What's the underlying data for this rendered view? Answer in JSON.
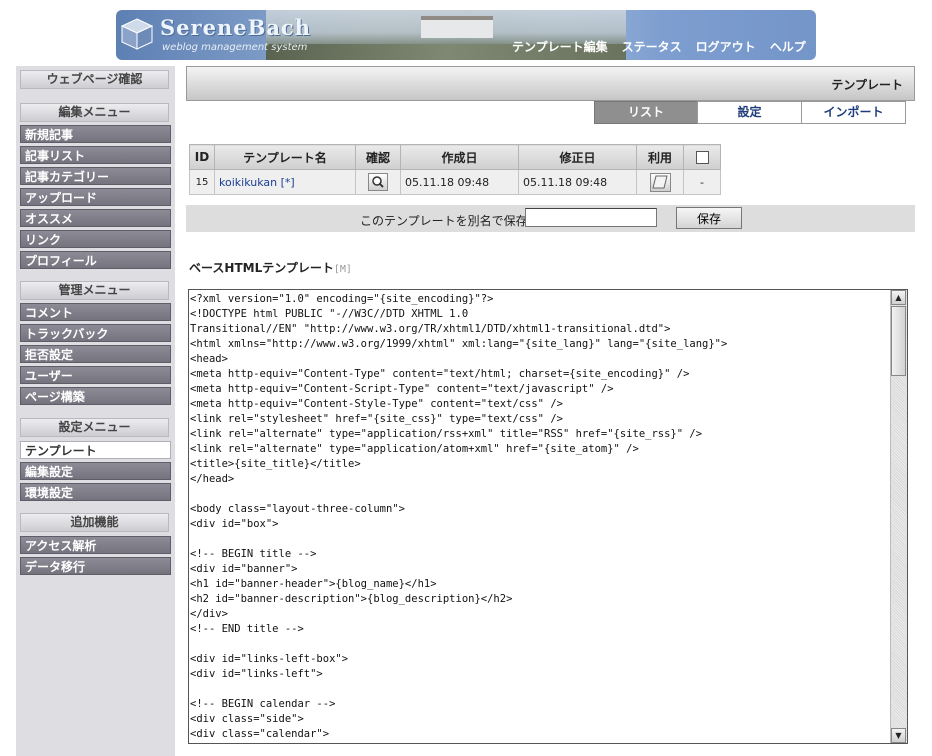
{
  "header": {
    "logo_title": "SereneBach",
    "logo_subtitle": "weblog management system",
    "nav": [
      "テンプレート編集",
      "ステータス",
      "ログアウト",
      "ヘルプ"
    ]
  },
  "sidebar": {
    "top_button": "ウェブページ確認",
    "sections": [
      {
        "title": "編集メニュー",
        "items": [
          "新規記事",
          "記事リスト",
          "記事カテゴリー",
          "アップロード",
          "オススメ",
          "リンク",
          "プロフィール"
        ]
      },
      {
        "title": "管理メニュー",
        "items": [
          "コメント",
          "トラックバック",
          "拒否設定",
          "ユーザー",
          "ページ構築"
        ]
      },
      {
        "title": "設定メニュー",
        "items": [
          "テンプレート",
          "編集設定",
          "環境設定"
        ],
        "active": "テンプレート"
      },
      {
        "title": "追加機能",
        "items": [
          "アクセス解析",
          "データ移行"
        ]
      }
    ]
  },
  "page": {
    "title": "テンプレート",
    "tabs": [
      {
        "label": "リスト",
        "active": true
      },
      {
        "label": "設定",
        "active": false
      },
      {
        "label": "インポート",
        "active": false
      }
    ]
  },
  "table": {
    "headers": [
      "ID",
      "テンプレート名",
      "確認",
      "作成日",
      "修正日",
      "利用"
    ],
    "rows": [
      {
        "id": "15",
        "name": "koikikukan [*]",
        "created": "05.11.18 09:48",
        "modified": "05.11.18 09:48",
        "select": "-"
      }
    ]
  },
  "save_as": {
    "label": "このテンプレートを別名で保存:",
    "value": "",
    "button": "保存"
  },
  "section": {
    "title": "ベースHTMLテンプレート",
    "marker": "[M]"
  },
  "code": {
    "lines": [
      "<?xml version=\"1.0\" encoding=\"{site_encoding}\"?>",
      "<!DOCTYPE html PUBLIC \"-//W3C//DTD XHTML 1.0",
      "Transitional//EN\" \"http://www.w3.org/TR/xhtml1/DTD/xhtml1-transitional.dtd\">",
      "<html xmlns=\"http://www.w3.org/1999/xhtml\" xml:lang=\"{site_lang}\" lang=\"{site_lang}\">",
      "<head>",
      "<meta http-equiv=\"Content-Type\" content=\"text/html; charset={site_encoding}\" />",
      "<meta http-equiv=\"Content-Script-Type\" content=\"text/javascript\" />",
      "<meta http-equiv=\"Content-Style-Type\" content=\"text/css\" />",
      "<link rel=\"stylesheet\" href=\"{site_css}\" type=\"text/css\" />",
      "<link rel=\"alternate\" type=\"application/rss+xml\" title=\"RSS\" href=\"{site_rss}\" />",
      "<link rel=\"alternate\" type=\"application/atom+xml\" href=\"{site_atom}\" />",
      "<title>{site_title}</title>",
      "</head>",
      "",
      "<body class=\"layout-three-column\">",
      "<div id=\"box\">",
      "",
      "<!-- BEGIN title -->",
      "<div id=\"banner\">",
      "<h1 id=\"banner-header\">{blog_name}</h1>",
      "<h2 id=\"banner-description\">{blog_description}</h2>",
      "</div>",
      "<!-- END title -->",
      "",
      "<div id=\"links-left-box\">",
      "<div id=\"links-left\">",
      "",
      "<!-- BEGIN calendar -->",
      "<div class=\"side\">",
      "<div class=\"calendar\">"
    ]
  }
}
